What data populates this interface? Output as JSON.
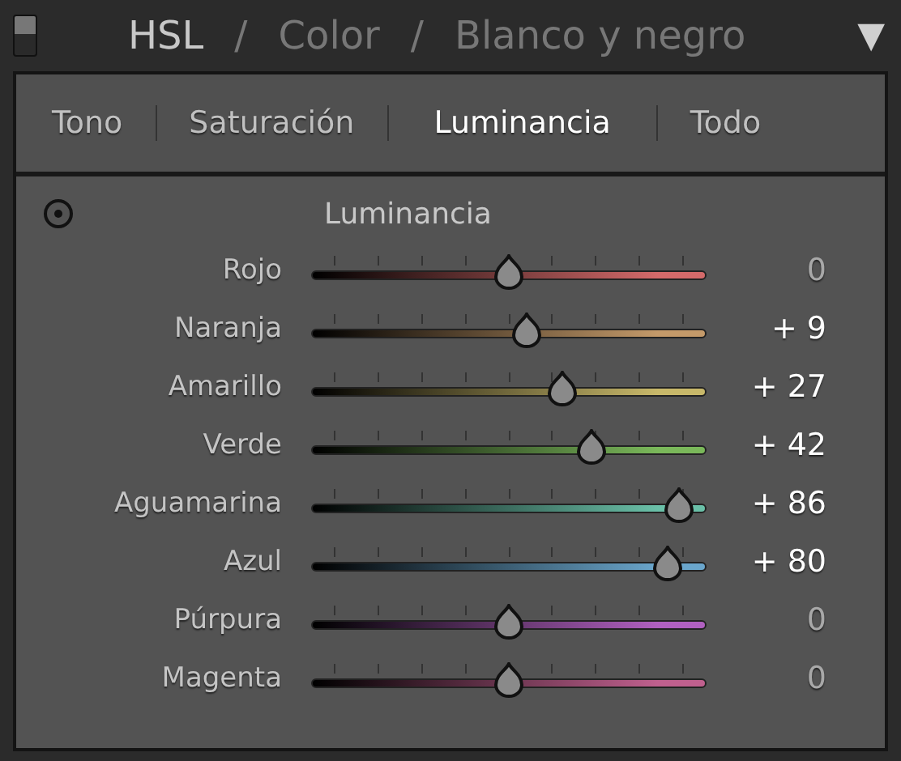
{
  "header": {
    "sections": [
      {
        "label": "HSL",
        "selected": true
      },
      {
        "label": "Color",
        "selected": false
      },
      {
        "label": "Blanco y negro",
        "selected": false
      }
    ],
    "separator": "/",
    "collapse": "▼"
  },
  "tabs": [
    {
      "label": "Tono",
      "selected": false
    },
    {
      "label": "Saturación",
      "selected": false
    },
    {
      "label": "Luminancia",
      "selected": true
    },
    {
      "label": "Todo",
      "selected": false
    }
  ],
  "panel_title": "Luminancia",
  "sliders": [
    {
      "name": "Rojo",
      "color": "#d46a6a",
      "level": 0.5,
      "reading": "0",
      "adjusted": false
    },
    {
      "name": "Naranja",
      "color": "#c49a6a",
      "level": 0.545,
      "reading": "+ 9",
      "adjusted": true
    },
    {
      "name": "Amarillo",
      "color": "#c8b86a",
      "level": 0.635,
      "reading": "+ 27",
      "adjusted": true
    },
    {
      "name": "Verde",
      "color": "#7ab85a",
      "level": 0.71,
      "reading": "+ 42",
      "adjusted": true
    },
    {
      "name": "Aguamarina",
      "color": "#6ac0a8",
      "level": 0.93,
      "reading": "+ 86",
      "adjusted": true
    },
    {
      "name": "Azul",
      "color": "#6aa6cc",
      "level": 0.9,
      "reading": "+ 80",
      "adjusted": true
    },
    {
      "name": "Púrpura",
      "color": "#b060c0",
      "level": 0.5,
      "reading": "0",
      "adjusted": false
    },
    {
      "name": "Magenta",
      "color": "#c0608e",
      "level": 0.5,
      "reading": "0",
      "adjusted": false
    }
  ]
}
